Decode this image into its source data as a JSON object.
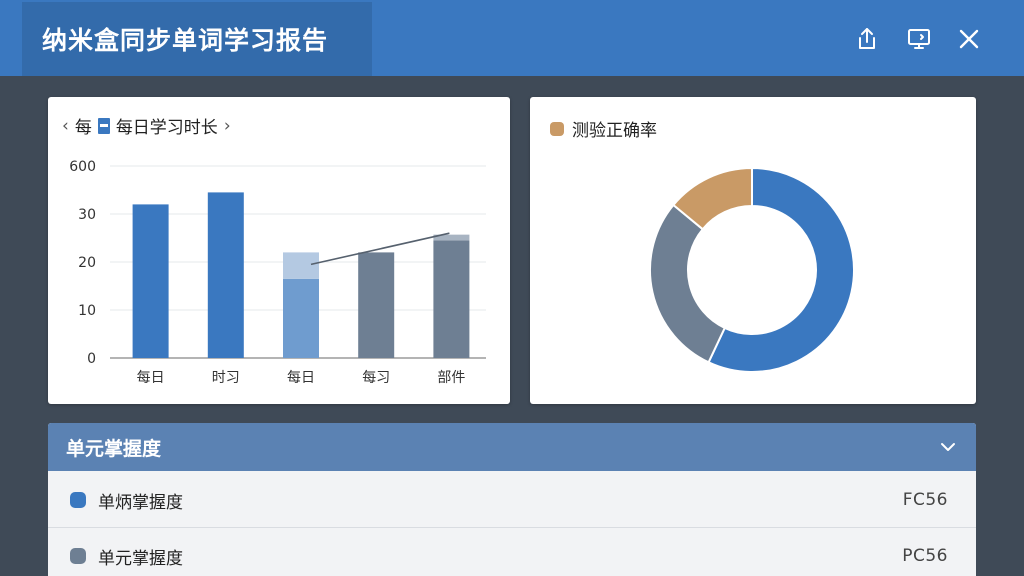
{
  "app": {
    "title": "纳米盒同步单词学习报告"
  },
  "header_icons": [
    "share-icon",
    "screen-icon",
    "close-icon"
  ],
  "colors": {
    "header": "#3a78c0",
    "primary_blue": "#3a78c0",
    "slate": "#6e7f93",
    "tan": "#c99a66",
    "light_blue": "#6f9ccf"
  },
  "bar_card": {
    "prev_label": "‹",
    "next_label": "›",
    "title_prefix": "每",
    "title": "每日学习时长"
  },
  "donut_card": {
    "legend_label": "测验正确率"
  },
  "chart_data": [
    {
      "type": "bar",
      "title": "每日学习时长",
      "categories": [
        "每日",
        "时习",
        "每日",
        "每习",
        "部件"
      ],
      "y_ticks": [
        "0",
        "10",
        "20",
        "30",
        "600"
      ],
      "ylim": [
        0,
        40
      ],
      "series": [
        {
          "values": [
            32,
            34.5,
            16.5,
            22,
            24.5
          ]
        },
        {
          "values": [
            0,
            0,
            5.5,
            0,
            1.2
          ]
        }
      ],
      "trend_line": [
        [
          2,
          19.5
        ],
        [
          4,
          26
        ]
      ],
      "grid": true
    },
    {
      "type": "pie",
      "title": "测验正确率",
      "legend": [
        "测验正确率"
      ],
      "slices": [
        {
          "value": 57,
          "color": "#3a78c0"
        },
        {
          "value": 29,
          "color": "#6e7f93"
        },
        {
          "value": 14,
          "color": "#c99a66"
        }
      ]
    }
  ],
  "unit_panel": {
    "title": "单元掌握度",
    "rows": [
      {
        "label": "单炳掌握度",
        "value": "FC56",
        "color": "#3a78c0"
      },
      {
        "label": "单元掌握度",
        "value": "PC56",
        "color": "#6e7f93"
      }
    ]
  }
}
